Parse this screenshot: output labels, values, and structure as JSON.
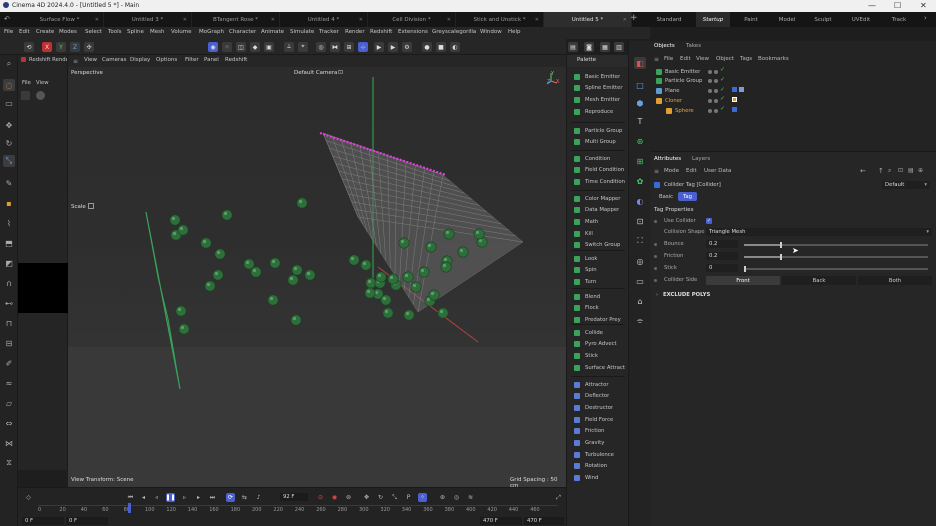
{
  "window": {
    "title": "Cinema 4D 2024.4.0 - [Untitled 5 *] - Main",
    "controls": [
      "—",
      "☐",
      "✕"
    ]
  },
  "doc_tabs": [
    "Surface Flow *",
    "Untitled 3 *",
    "BTangent Rose *",
    "Untitled 4 *",
    "Cell Division *",
    "Stick and Unstick *",
    "Untitled 5 *"
  ],
  "active_doc_tab_index": 6,
  "layouts": [
    "Standard",
    "Startup",
    "Paint",
    "Model",
    "Sculpt",
    "UVEdit",
    "Track"
  ],
  "active_layout_index": 1,
  "menu": [
    "File",
    "Edit",
    "Create",
    "Modes",
    "Select",
    "Tools",
    "Spline",
    "Mesh",
    "Volume",
    "MoGraph",
    "Character",
    "Animate",
    "Simulate",
    "Tracker",
    "Render",
    "Redshift",
    "Extensions",
    "Greyscalegorilla",
    "Window",
    "Help"
  ],
  "axis_buttons": [
    "X",
    "Y",
    "Z"
  ],
  "redshift_panel": {
    "title": "Redshift Rende",
    "menu": [
      "File",
      "View"
    ]
  },
  "viewport": {
    "menu": [
      "View",
      "Cameras",
      "Display",
      "Options",
      "Filter",
      "Panel",
      "Redshift"
    ],
    "mode_label": "Perspective",
    "camera_label": "Default Camera",
    "scale_label": "Scale",
    "transform_label": "View Transform: Scene",
    "grid_spacing": "Grid Spacing : 50 cm",
    "axis_labels": [
      "Y",
      "X",
      "Z"
    ]
  },
  "timeline": {
    "current_frame": "92 F",
    "ticks": [
      "0",
      "20",
      "40",
      "60",
      "80",
      "100",
      "120",
      "140",
      "160",
      "180",
      "200",
      "220",
      "240",
      "260",
      "280",
      "300",
      "320",
      "340",
      "360",
      "380",
      "400",
      "420",
      "440",
      "460"
    ],
    "start_a": "0 F",
    "start_b": "0 F",
    "end_a": "470 F",
    "end_b": "470 F"
  },
  "palette": {
    "title": "Palette",
    "groups": [
      [
        {
          "label": "Basic Emitter",
          "color": "#3aa35a"
        },
        {
          "label": "Spline Emitter",
          "color": "#3aa35a"
        },
        {
          "label": "Mesh Emitter",
          "color": "#3aa35a"
        },
        {
          "label": "Reproduce",
          "color": "#3aa35a"
        }
      ],
      [
        {
          "label": "Particle Group",
          "color": "#3aa35a"
        },
        {
          "label": "Multi Group",
          "color": "#3aa35a"
        }
      ],
      [
        {
          "label": "Condition",
          "color": "#3aa35a"
        },
        {
          "label": "Field Condition",
          "color": "#3aa35a"
        },
        {
          "label": "Time Condition",
          "color": "#3aa35a"
        }
      ],
      [
        {
          "label": "Color Mapper",
          "color": "#3aa35a"
        },
        {
          "label": "Data Mapper",
          "color": "#3aa35a"
        },
        {
          "label": "Math",
          "color": "#3aa35a"
        },
        {
          "label": "Kill",
          "color": "#3aa35a"
        },
        {
          "label": "Switch Group",
          "color": "#3aa35a"
        }
      ],
      [
        {
          "label": "Look",
          "color": "#3aa35a"
        },
        {
          "label": "Spin",
          "color": "#3aa35a"
        },
        {
          "label": "Turn",
          "color": "#3aa35a"
        }
      ],
      [
        {
          "label": "Blend",
          "color": "#3aa35a"
        },
        {
          "label": "Flock",
          "color": "#3aa35a"
        },
        {
          "label": "Predator Prey",
          "color": "#3aa35a"
        }
      ],
      [
        {
          "label": "Collide",
          "color": "#3aa35a"
        },
        {
          "label": "Pyro Advect",
          "color": "#3aa35a"
        },
        {
          "label": "Stick",
          "color": "#3aa35a"
        },
        {
          "label": "Surface Attract",
          "color": "#3aa35a"
        }
      ],
      [
        {
          "label": "Attractor",
          "color": "#5a7bd8"
        },
        {
          "label": "Deflector",
          "color": "#5a7bd8"
        },
        {
          "label": "Destructor",
          "color": "#5a7bd8"
        },
        {
          "label": "Field Force",
          "color": "#5a7bd8"
        },
        {
          "label": "Friction",
          "color": "#5a7bd8"
        },
        {
          "label": "Gravity",
          "color": "#5a7bd8"
        },
        {
          "label": "Turbulence",
          "color": "#5a7bd8"
        },
        {
          "label": "Rotation",
          "color": "#5a7bd8"
        },
        {
          "label": "Wind",
          "color": "#5a7bd8"
        }
      ]
    ]
  },
  "objects_panel": {
    "tabs": [
      "Objects",
      "Takes"
    ],
    "menu": [
      "File",
      "Edit",
      "View",
      "Object",
      "Tags",
      "Bookmarks"
    ],
    "rows": [
      {
        "label": "Basic Emitter",
        "color": "#3aa35a",
        "indent": 0,
        "label_color": "#c8c8c8"
      },
      {
        "label": "Particle Group",
        "color": "#3aa35a",
        "indent": 0,
        "label_color": "#c8c8c8"
      },
      {
        "label": "Plane",
        "color": "#5a9bd8",
        "indent": 0,
        "label_color": "#c8c8c8"
      },
      {
        "label": "Cloner",
        "color": "#e0a030",
        "indent": 0,
        "label_color": "#e8a840"
      },
      {
        "label": "Sphere",
        "color": "#e0a030",
        "indent": 1,
        "label_color": "#e8a840"
      }
    ]
  },
  "attributes_panel": {
    "tabs": [
      "Attributes",
      "Layers"
    ],
    "menu": [
      "Mode",
      "Edit",
      "User Data"
    ],
    "object_label": "Collider Tag [Collider]",
    "preset": "Default",
    "sub_tabs": [
      "Basic",
      "Tag"
    ],
    "active_sub_tab": 1,
    "section": "Tag Properties",
    "use_collider_label": "Use Collider",
    "use_collider": true,
    "collision_shape_label": "Collision Shape",
    "collision_shape_value": "Triangle Mesh",
    "bounce_label": "Bounce",
    "bounce_value": "0.2",
    "bounce_fraction": 0.2,
    "friction_label": "Friction",
    "friction_value": "0.2",
    "friction_fraction": 0.2,
    "stick_label": "Stick",
    "stick_value": "0",
    "stick_fraction": 0,
    "collider_side_label": "Collider Side",
    "collider_side_options": [
      "Front",
      "Back",
      "Both"
    ],
    "collider_side_active": 0,
    "exclude_label": "EXCLUDE POLYS"
  },
  "colors": {
    "accent_blue": "#4a5fd0",
    "particle_green": "#2e6e3a",
    "check_green": "#44cc44",
    "selected_magenta": "#e040e0"
  }
}
